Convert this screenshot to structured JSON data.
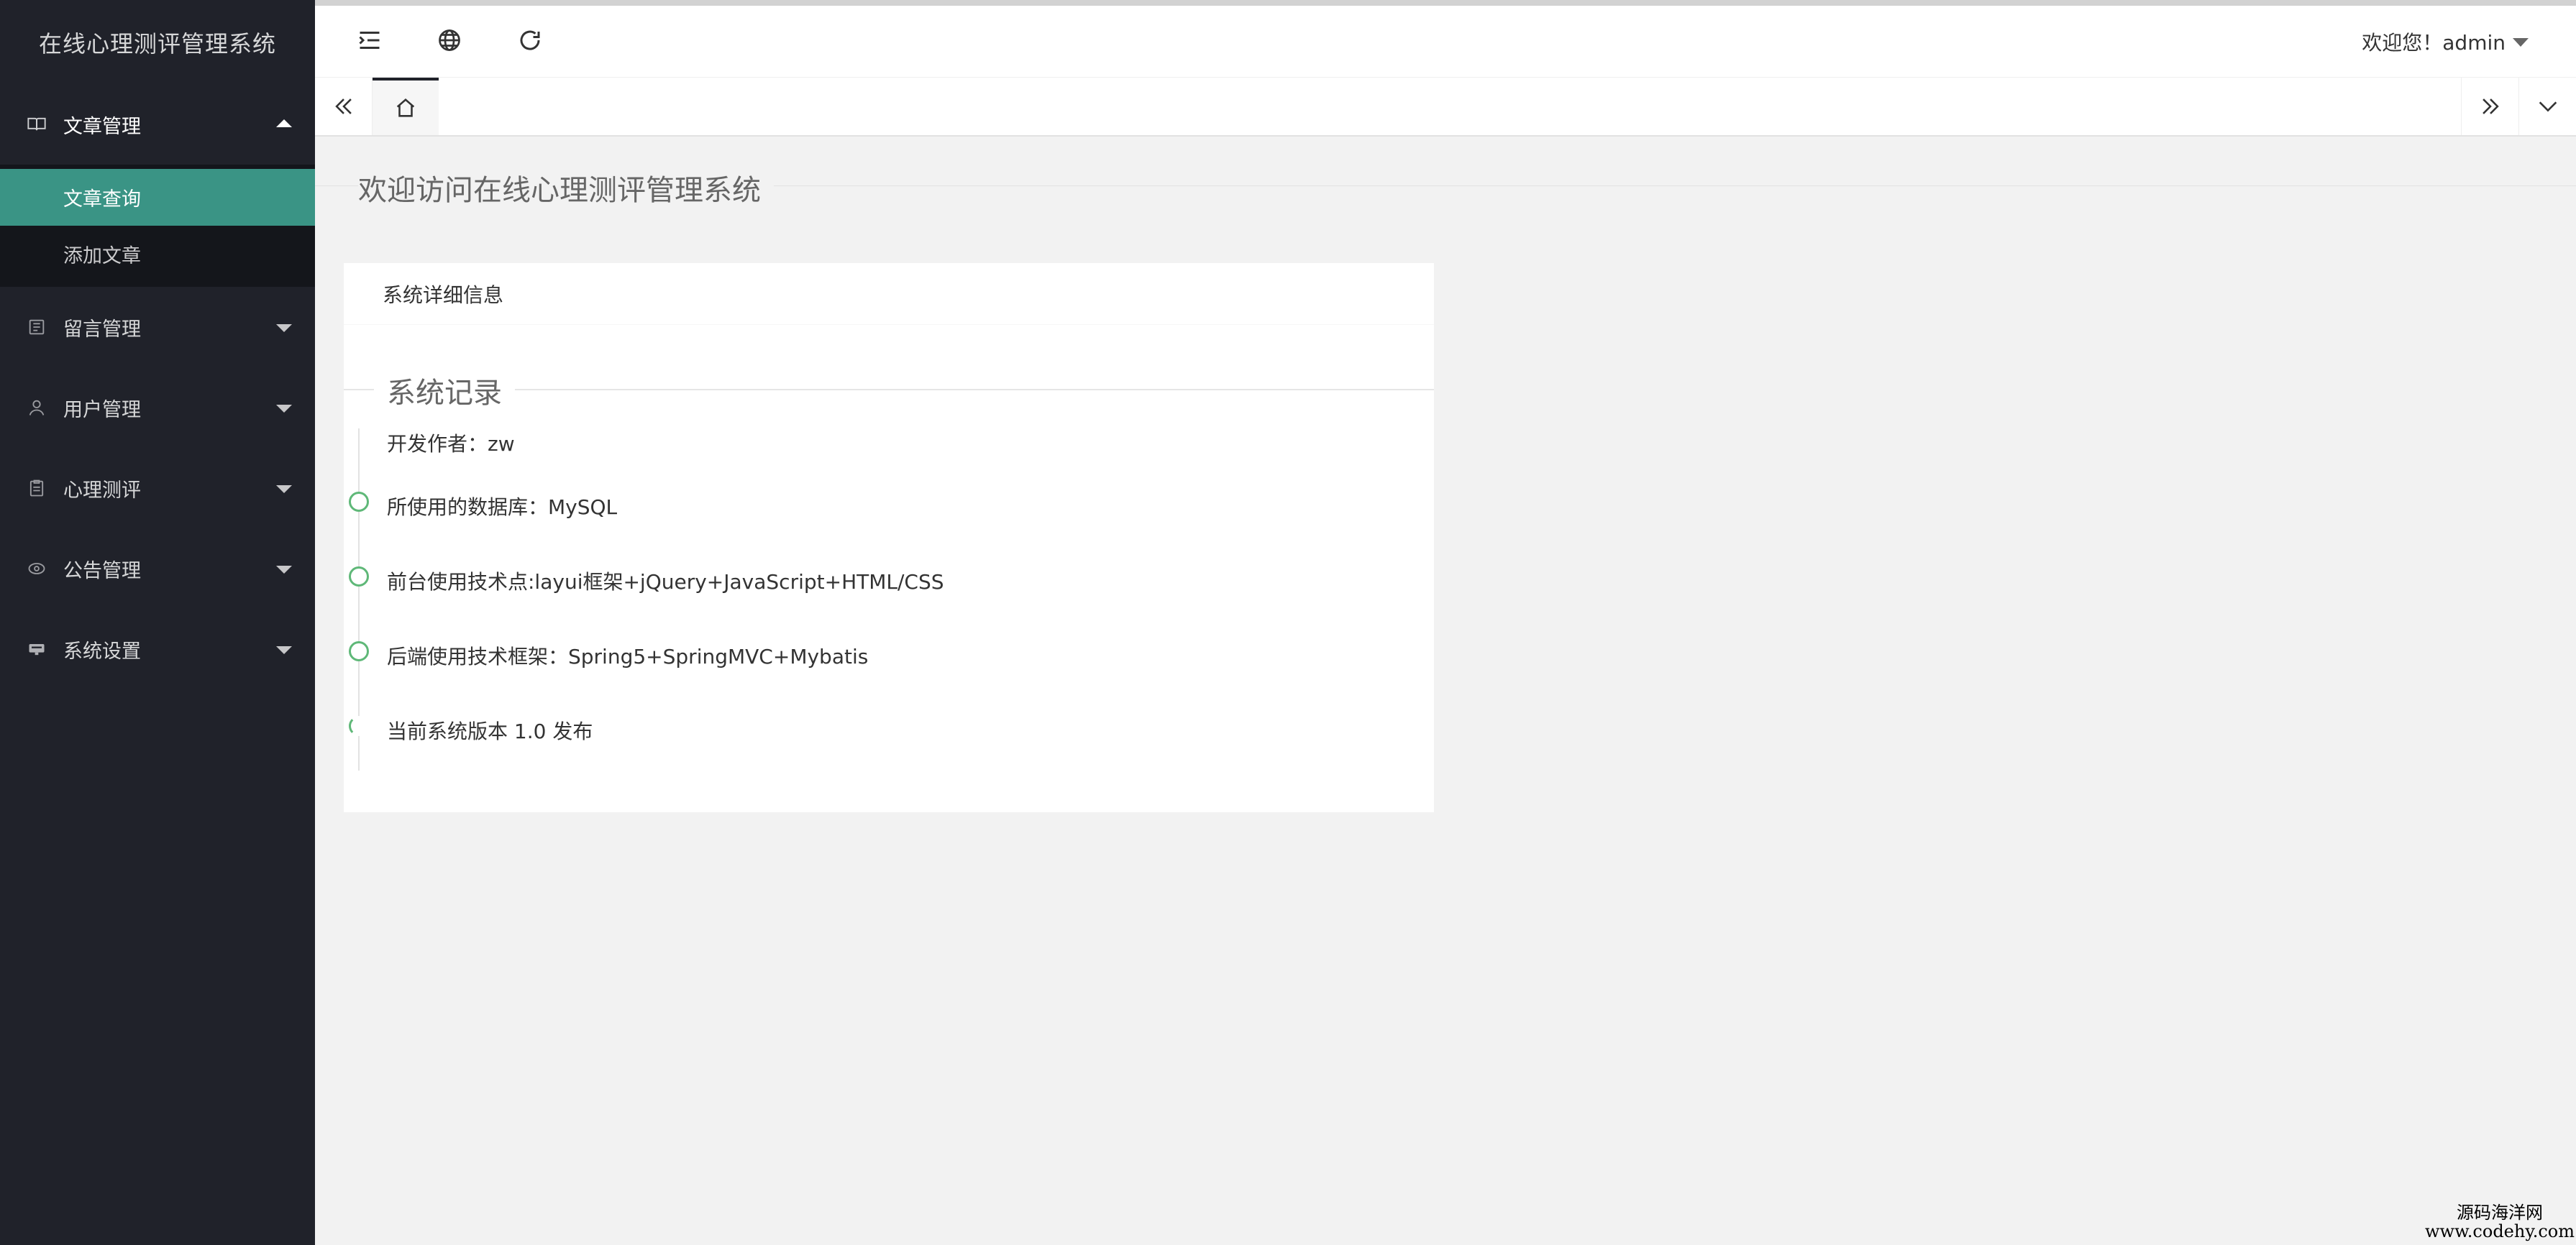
{
  "app": {
    "title": "在线心理测评管理系统"
  },
  "sidebar": {
    "items": [
      {
        "label": "文章管理",
        "icon": "book-icon",
        "expanded": true,
        "children": [
          {
            "label": "文章查询",
            "active": true
          },
          {
            "label": "添加文章",
            "active": false
          }
        ]
      },
      {
        "label": "留言管理",
        "icon": "message-icon",
        "expanded": false
      },
      {
        "label": "用户管理",
        "icon": "user-icon",
        "expanded": false
      },
      {
        "label": "心理测评",
        "icon": "clipboard-icon",
        "expanded": false
      },
      {
        "label": "公告管理",
        "icon": "notice-icon",
        "expanded": false
      },
      {
        "label": "系统设置",
        "icon": "settings-icon",
        "expanded": false
      }
    ]
  },
  "header": {
    "icons": [
      "menu-toggle-icon",
      "globe-icon",
      "refresh-icon"
    ],
    "user_label": "欢迎您！admin"
  },
  "tabs": {
    "home_icon": "home-icon"
  },
  "main": {
    "welcome_title": "欢迎访问在线心理测评管理系统",
    "card_title": "系统详细信息",
    "section_title": "系统记录",
    "timeline": [
      "开发作者：zw",
      "所使用的数据库：MySQL",
      "前台使用技术点:layui框架+jQuery+JavaScript+HTML/CSS",
      "后端使用技术框架：Spring5+SpringMVC+Mybatis",
      "当前系统版本 1.0 发布"
    ]
  },
  "watermark": {
    "line1": "源码海洋网",
    "line2": "www.codehy.com"
  },
  "colors": {
    "sidebar_bg": "#20222a",
    "active": "#3a9485",
    "timeline": "#5fb878"
  }
}
